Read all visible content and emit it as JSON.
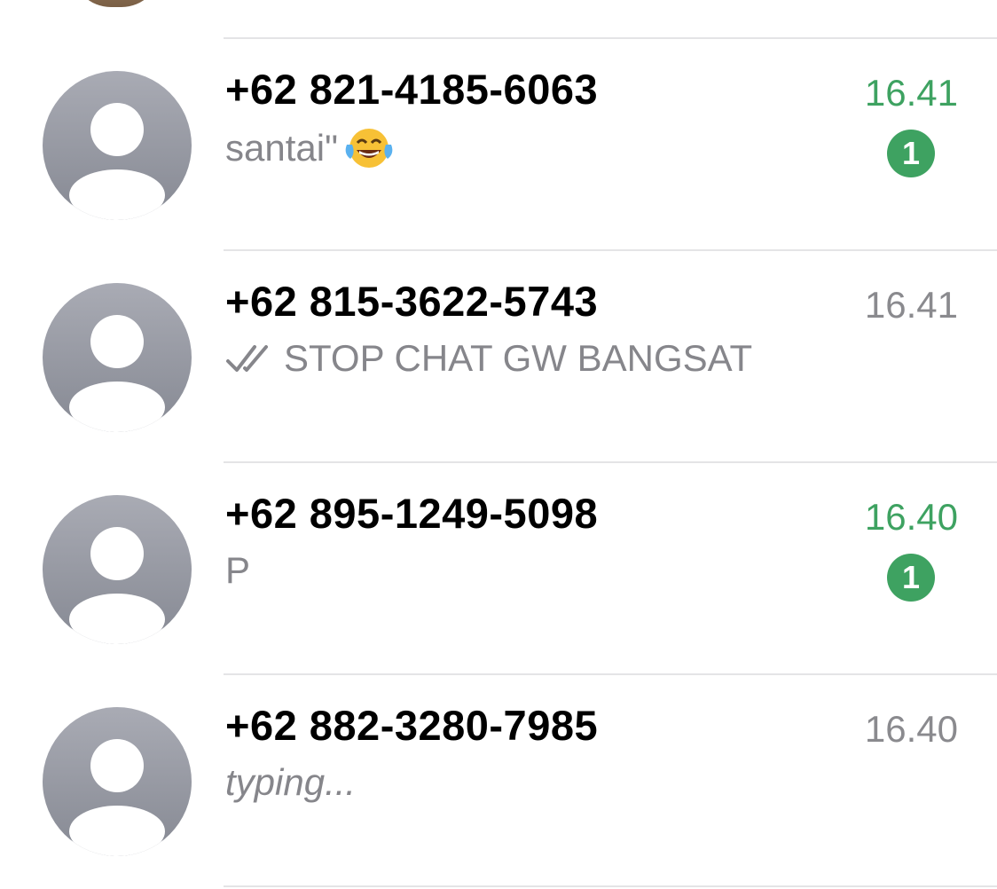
{
  "chats": [
    {
      "name": "+62 821-4185-6063",
      "time": "16.41",
      "preview": "santai\"",
      "preview_emoji": "face-with-tears-of-joy",
      "unread_count": "1",
      "time_color": "#3ea261"
    },
    {
      "name": "+62 815-3622-5743",
      "time": "16.41",
      "preview": "STOP CHAT GW BANGSAT",
      "preview_icon": "double-check-icon",
      "time_color": "#8a8a8e"
    },
    {
      "name": "+62 895-1249-5098",
      "time": "16.40",
      "preview": "P",
      "unread_count": "1",
      "time_color": "#3ea261"
    },
    {
      "name": "+62 882-3280-7985",
      "time": "16.40",
      "preview": "typing...",
      "time_color": "#8a8a8e"
    }
  ],
  "colors": {
    "accent_green": "#3ea261",
    "secondary_text": "#86868b",
    "divider": "#e4e4e6",
    "avatar_gray": "#9a9ca5"
  }
}
